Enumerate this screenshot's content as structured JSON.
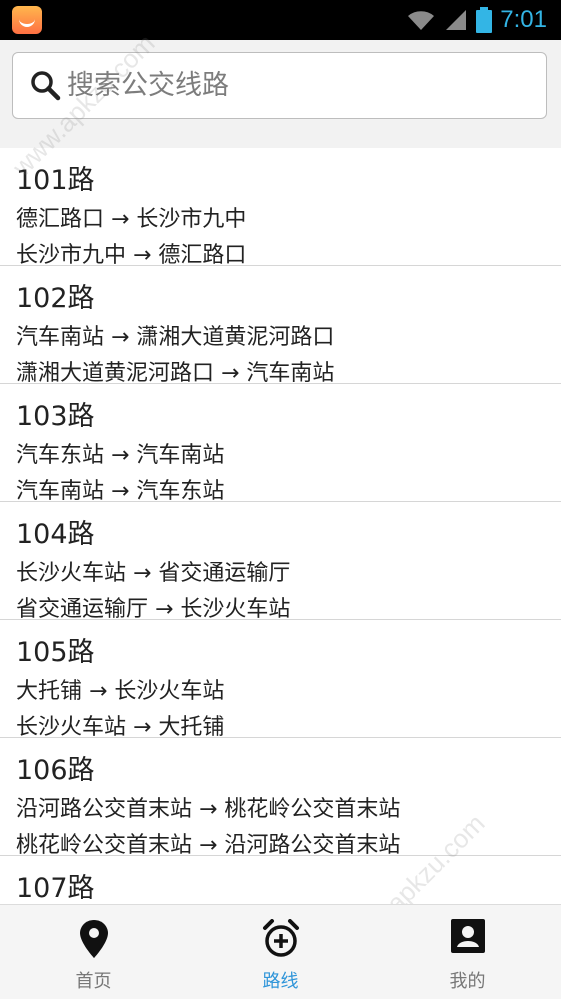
{
  "status_bar": {
    "time": "7:01"
  },
  "search": {
    "placeholder": "搜索公交线路"
  },
  "routes": [
    {
      "name": "101路",
      "dir1": "德汇路口 → 长沙市九中",
      "dir2": "长沙市九中 → 德汇路口"
    },
    {
      "name": "102路",
      "dir1": "汽车南站 → 潇湘大道黄泥河路口",
      "dir2": "潇湘大道黄泥河路口 → 汽车南站"
    },
    {
      "name": "103路",
      "dir1": "汽车东站 → 汽车南站",
      "dir2": "汽车南站 → 汽车东站"
    },
    {
      "name": "104路",
      "dir1": "长沙火车站 → 省交通运输厅",
      "dir2": "省交通运输厅 → 长沙火车站"
    },
    {
      "name": "105路",
      "dir1": "大托铺 → 长沙火车站",
      "dir2": "长沙火车站 → 大托铺"
    },
    {
      "name": "106路",
      "dir1": "沿河路公交首末站 → 桃花岭公交首末站",
      "dir2": "桃花岭公交首末站 → 沿河路公交首末站"
    },
    {
      "name": "107路",
      "dir1": "",
      "dir2": ""
    }
  ],
  "nav": [
    {
      "label": "首页",
      "icon": "location-pin-icon",
      "active": false
    },
    {
      "label": "路线",
      "icon": "alarm-clock-icon",
      "active": true
    },
    {
      "label": "我的",
      "icon": "contact-card-icon",
      "active": false
    }
  ],
  "colors": {
    "accent": "#2f95d9",
    "status_icons": "#33b5e5"
  },
  "watermark": "www.apkzu.com"
}
